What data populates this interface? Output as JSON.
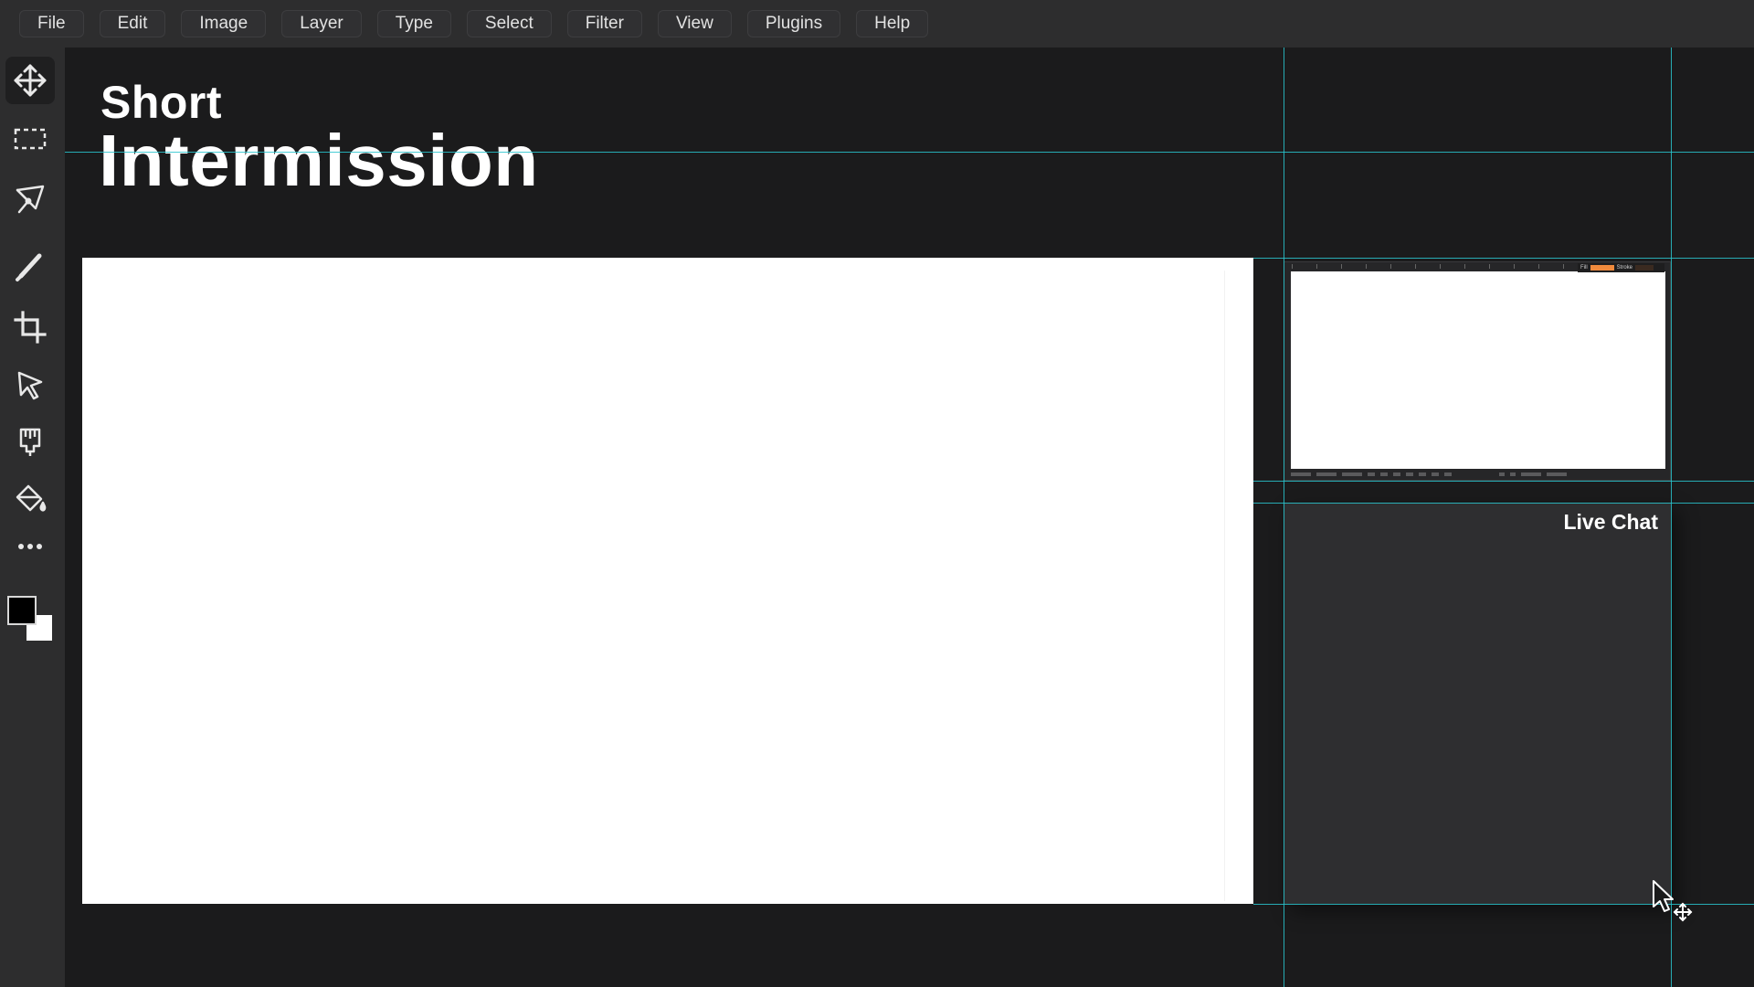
{
  "menu": {
    "items": [
      {
        "id": "file",
        "label": "File"
      },
      {
        "id": "edit",
        "label": "Edit"
      },
      {
        "id": "image",
        "label": "Image"
      },
      {
        "id": "layer",
        "label": "Layer"
      },
      {
        "id": "type",
        "label": "Type"
      },
      {
        "id": "select",
        "label": "Select"
      },
      {
        "id": "filter",
        "label": "Filter"
      },
      {
        "id": "view",
        "label": "View"
      },
      {
        "id": "plugins",
        "label": "Plugins"
      },
      {
        "id": "help",
        "label": "Help"
      }
    ]
  },
  "tools": [
    {
      "icon": "move-icon",
      "active": true
    },
    {
      "icon": "marquee-select-icon",
      "active": false
    },
    {
      "icon": "pen-tool-icon",
      "active": false
    },
    {
      "icon": "brush-icon",
      "active": false
    },
    {
      "icon": "crop-icon",
      "active": false
    },
    {
      "icon": "direct-select-icon",
      "active": false
    },
    {
      "icon": "stamp-icon",
      "active": false
    },
    {
      "icon": "paint-bucket-icon",
      "active": false
    },
    {
      "icon": "more-tools-icon",
      "active": false
    }
  ],
  "colors": {
    "foreground": "#000000",
    "background": "#ffffff",
    "guide": "#29c5cf",
    "fill_chip": "#f08a3c"
  },
  "canvas": {
    "title_small": "Short",
    "title_large": "Intermission",
    "chat_title": "Live Chat",
    "thumb_fill_label": "Fill",
    "thumb_stroke_label": "Stroke"
  }
}
